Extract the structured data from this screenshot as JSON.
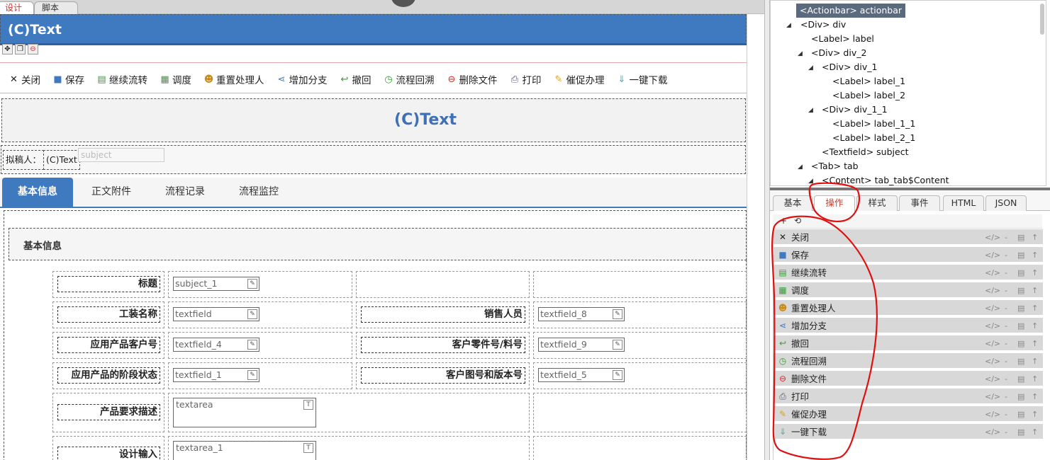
{
  "editor_tabs": [
    {
      "label": "设计"
    },
    {
      "label": "脚本"
    }
  ],
  "form": {
    "title_bar_text": "(C)Text",
    "heading_text": "(C)Text",
    "drafter_label": "拟稿人：",
    "drafter_value": "(C)Text",
    "subject_placeholder": "subject",
    "actions": [
      {
        "label": "关闭",
        "icon": "close-icon"
      },
      {
        "label": "保存",
        "icon": "save-icon"
      },
      {
        "label": "继续流转",
        "icon": "continue-flow-icon"
      },
      {
        "label": "调度",
        "icon": "dispatch-icon"
      },
      {
        "label": "重置处理人",
        "icon": "reset-handler-icon"
      },
      {
        "label": "增加分支",
        "icon": "add-branch-icon"
      },
      {
        "label": "撤回",
        "icon": "withdraw-icon"
      },
      {
        "label": "流程回溯",
        "icon": "flow-trace-icon"
      },
      {
        "label": "删除文件",
        "icon": "delete-file-icon"
      },
      {
        "label": "打印",
        "icon": "print-icon"
      },
      {
        "label": "催促办理",
        "icon": "urge-icon"
      },
      {
        "label": "一键下载",
        "icon": "download-icon"
      }
    ],
    "tabs": [
      {
        "label": "基本信息"
      },
      {
        "label": "正文附件"
      },
      {
        "label": "流程记录"
      },
      {
        "label": "流程监控"
      }
    ],
    "section_title": "基本信息",
    "fields": {
      "title_label": "标题",
      "title_value": "subject_1",
      "craft_label": "工装名称",
      "craft_value": "textfield",
      "sales_label": "销售人员",
      "sales_value": "textfield_8",
      "customer_no_label": "应用产品客户号",
      "customer_no_value": "textfield_4",
      "part_no_label": "客户零件号/料号",
      "part_no_value": "textfield_9",
      "stage_label": "应用产品的阶段状态",
      "stage_value": "textfield_1",
      "drawing_label": "客户图号和版本号",
      "drawing_value": "textfield_5",
      "requirement_label": "产品要求描述",
      "requirement_value": "textarea",
      "design_input_label": "设计输入",
      "design_input_value": "textarea_1"
    }
  },
  "tree": {
    "nodes": [
      {
        "text": "<Actionbar> actionbar"
      },
      {
        "text": "<Div> div"
      },
      {
        "text": "<Label> label"
      },
      {
        "text": "<Div> div_2"
      },
      {
        "text": "<Div> div_1"
      },
      {
        "text": "<Label> label_1"
      },
      {
        "text": "<Label> label_2"
      },
      {
        "text": "<Div> div_1_1"
      },
      {
        "text": "<Label> label_1_1"
      },
      {
        "text": "<Label> label_2_1"
      },
      {
        "text": "<Textfield> subject"
      },
      {
        "text": "<Tab> tab"
      },
      {
        "text": "<Content> tab_tab$Content"
      }
    ]
  },
  "props": {
    "tabs": [
      {
        "label": "基本"
      },
      {
        "label": "操作"
      },
      {
        "label": "样式"
      },
      {
        "label": "事件"
      },
      {
        "label": "HTML"
      },
      {
        "label": "JSON"
      }
    ],
    "toolbar": {
      "add": "+",
      "reset": "⟲"
    },
    "row_controls": {
      "code": "</>",
      "minus": "-",
      "edit": "▤",
      "up": "↑"
    },
    "operations": [
      {
        "label": "关闭",
        "icon": "close-icon"
      },
      {
        "label": "保存",
        "icon": "save-icon"
      },
      {
        "label": "继续流转",
        "icon": "continue-flow-icon"
      },
      {
        "label": "调度",
        "icon": "dispatch-icon"
      },
      {
        "label": "重置处理人",
        "icon": "reset-handler-icon"
      },
      {
        "label": "增加分支",
        "icon": "add-branch-icon"
      },
      {
        "label": "撤回",
        "icon": "withdraw-icon"
      },
      {
        "label": "流程回溯",
        "icon": "flow-trace-icon"
      },
      {
        "label": "删除文件",
        "icon": "delete-file-icon"
      },
      {
        "label": "打印",
        "icon": "print-icon"
      },
      {
        "label": "催促办理",
        "icon": "urge-icon"
      },
      {
        "label": "一键下载",
        "icon": "download-icon"
      }
    ]
  },
  "colors": {
    "brand_blue": "#3f7ac0",
    "heading_blue": "#3f6fb4",
    "active_ops_tab": "#c8402e",
    "annotation_red": "#e01010"
  }
}
